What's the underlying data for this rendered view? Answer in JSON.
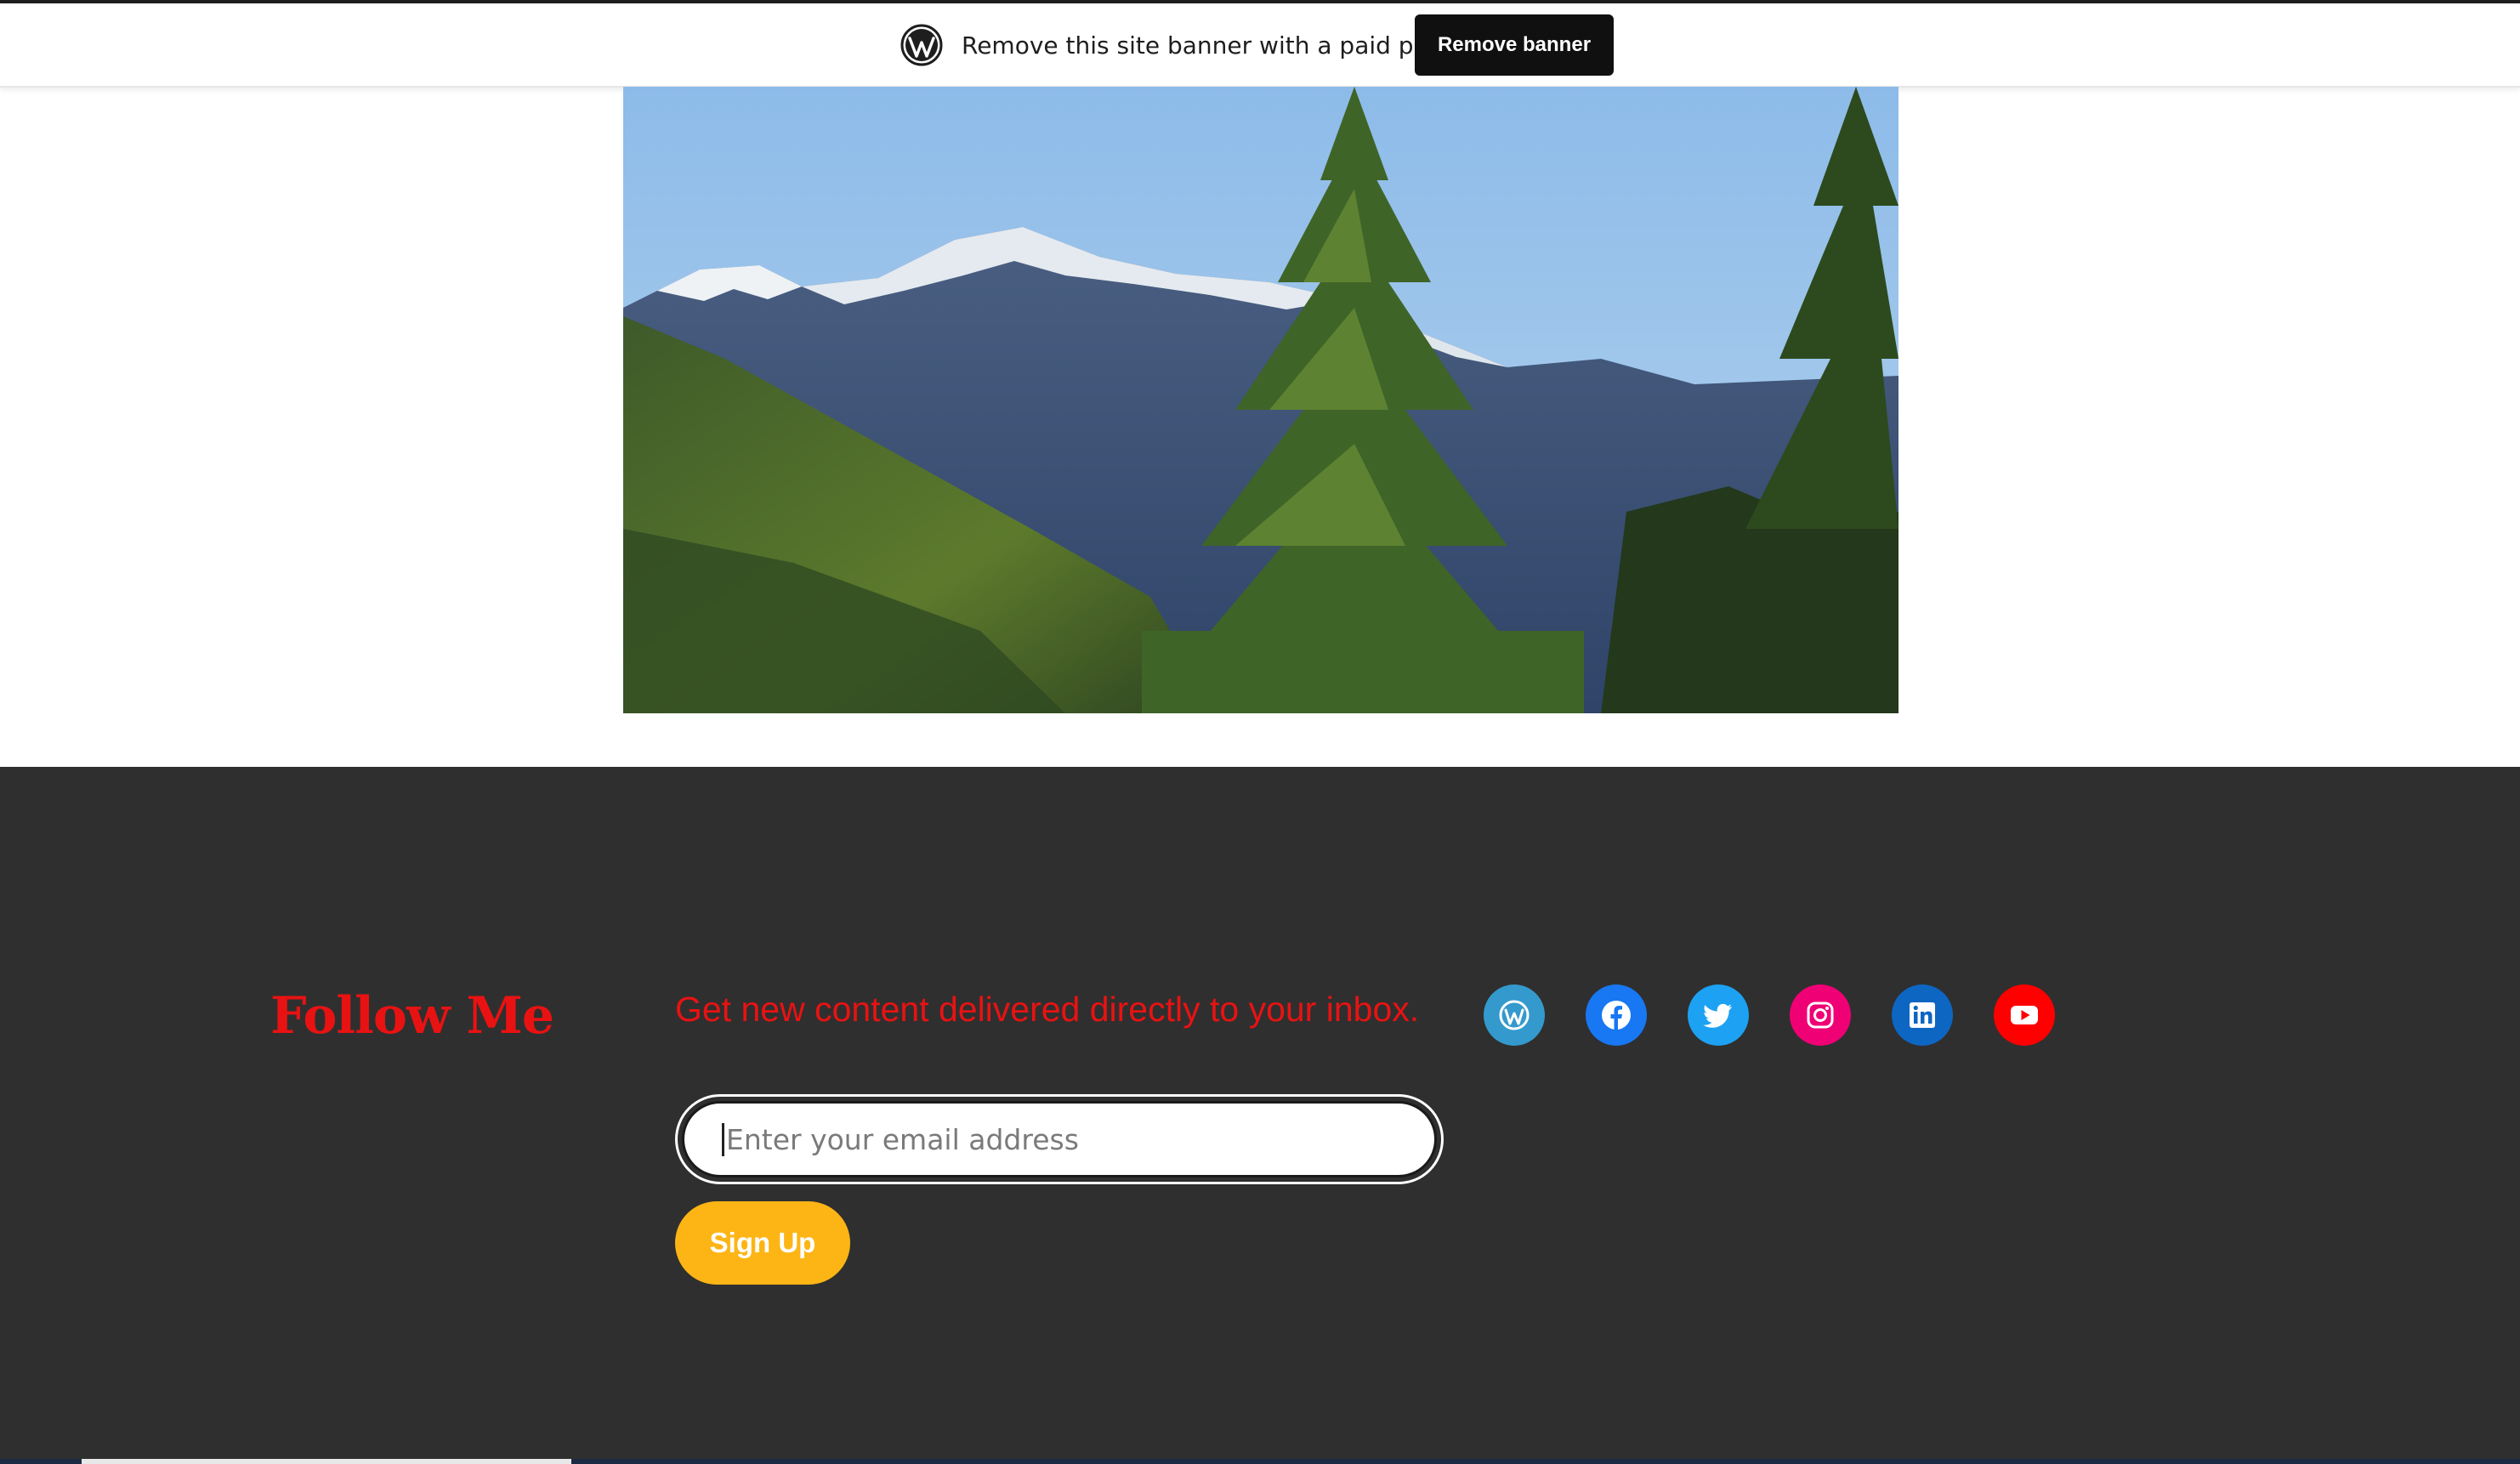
{
  "banner": {
    "text": "Remove this site banner with a paid plan",
    "button_label": "Remove banner",
    "logo_icon": "wordpress-logo-icon"
  },
  "hero": {
    "image": "mountain-landscape-photo"
  },
  "footer": {
    "title": "Follow Me",
    "subscribe_text": "Get new content delivered directly to your inbox.",
    "email_placeholder": "Enter your email address",
    "signup_label": "Sign Up",
    "colors": {
      "background": "#2f2f2f",
      "accent_red": "#e91212",
      "button_yellow": "#fdb515"
    },
    "social_links": [
      {
        "name": "WordPress",
        "icon": "wordpress-icon",
        "color": "#3499cd"
      },
      {
        "name": "Facebook",
        "icon": "facebook-icon",
        "color": "#1877f2"
      },
      {
        "name": "Twitter",
        "icon": "twitter-icon",
        "color": "#1da1f2"
      },
      {
        "name": "Instagram",
        "icon": "instagram-icon",
        "color": "#f00075"
      },
      {
        "name": "LinkedIn",
        "icon": "linkedin-icon",
        "color": "#0d66c2"
      },
      {
        "name": "YouTube",
        "icon": "youtube-icon",
        "color": "#ff0000"
      }
    ]
  }
}
